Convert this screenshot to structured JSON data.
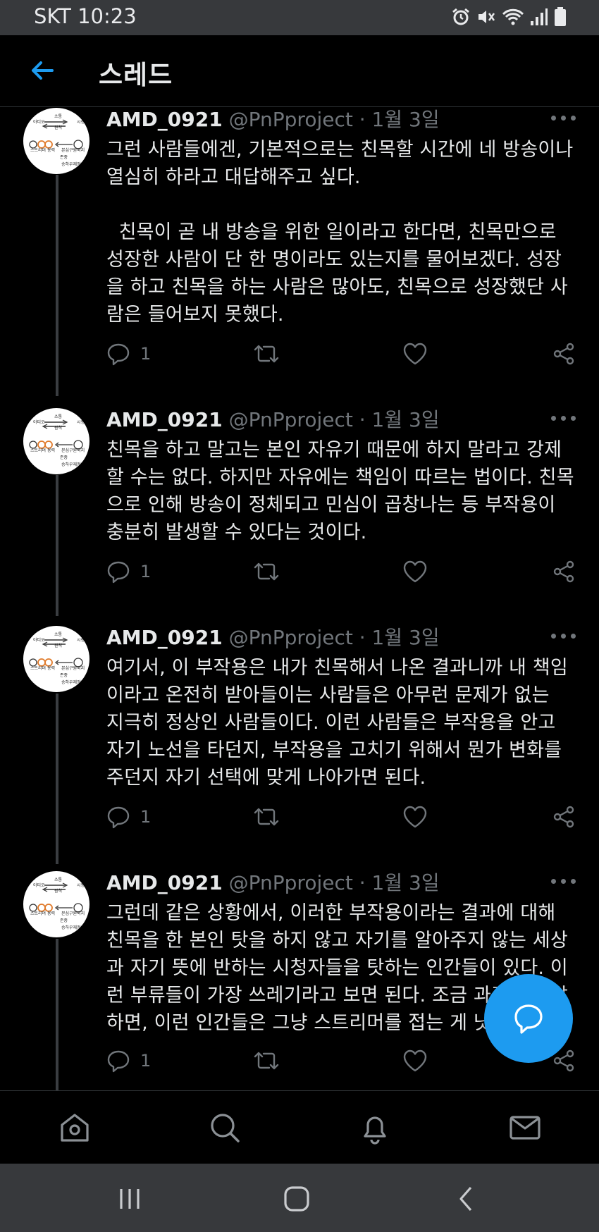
{
  "status_bar": {
    "carrier_time": "SKT 10:23",
    "icons": [
      "alarm-icon",
      "mute-icon",
      "wifi-icon",
      "signal-icon",
      "battery-icon"
    ]
  },
  "header": {
    "back_icon": "arrow-left-icon",
    "title": "스레드"
  },
  "colors": {
    "accent": "#1d9bf0",
    "background": "#000000",
    "secondary_text": "#71767b",
    "primary_text": "#e7e9ea"
  },
  "tweets": [
    {
      "name": "AMD_0921",
      "handle": "@PnPproject",
      "separator": "·",
      "date": "1월 3일",
      "text": "그런 사람들에겐, 기본적으로는 친목할 시간에 네 방송이나\n열심히 하라고 대답해주고 싶다.\n\n  친목이 곧 내 방송을 위한 일이라고 한다면, 친목만으로\n성장한 사람이 단 한 명이라도 있는지를 물어보겠다. 성장\n을 하고 친목을 하는 사람은 많아도, 친목으로 성장했단 사\n람은 들어보지 못했다.",
      "reply_count": "1"
    },
    {
      "name": "AMD_0921",
      "handle": "@PnPproject",
      "separator": "·",
      "date": "1월 3일",
      "text": "친목을 하고 말고는 본인 자유기 때문에 하지 말라고 강제\n할 수는 없다. 하지만 자유에는 책임이 따르는 법이다. 친목\n으로 인해 방송이 정체되고 민심이 곱창나는 등 부작용이\n충분히 발생할 수 있다는 것이다.",
      "reply_count": "1"
    },
    {
      "name": "AMD_0921",
      "handle": "@PnPproject",
      "separator": "·",
      "date": "1월 3일",
      "text": "여기서, 이 부작용은 내가 친목해서 나온 결과니까 내 책임\n이라고 온전히 받아들이는 사람들은 아무런 문제가 없는\n지극히 정상인 사람들이다. 이런 사람들은 부작용을 안고\n자기 노선을 타던지, 부작용을 고치기 위해서 뭔가 변화를\n주던지 자기 선택에 맞게 나아가면 된다.",
      "reply_count": "1"
    },
    {
      "name": "AMD_0921",
      "handle": "@PnPproject",
      "separator": "·",
      "date": "1월 3일",
      "text": "그런데 같은 상황에서, 이러한 부작용이라는 결과에 대해\n친목을 한 본인 탓을 하지 않고 자기를 알아주지 않는 세상\n과 자기 뜻에 반하는 시청자들을 탓하는 인간들이 있다. 이\n런 부류들이 가장 쓰레기라고 보면 된다. 조금 과격하게 말\n하면, 이런 인간들은 그냥 스트리머를 접는 게 낫다.",
      "reply_count": "1"
    }
  ],
  "avatar": {
    "image_texts": [
      "아티오",
      "소통",
      "시청자",
      "원칙",
      "스트리머 용력",
      "본심구원되지",
      "존중",
      "승하우재정하"
    ]
  },
  "action_icons": [
    "reply-icon",
    "retweet-icon",
    "like-icon",
    "share-icon"
  ],
  "fab": {
    "icon": "compose-message-icon"
  },
  "bottom_nav": [
    "home-icon",
    "search-icon",
    "notifications-icon",
    "messages-icon"
  ],
  "system_nav": [
    "recent-apps-icon",
    "home-button-icon",
    "back-button-icon"
  ]
}
